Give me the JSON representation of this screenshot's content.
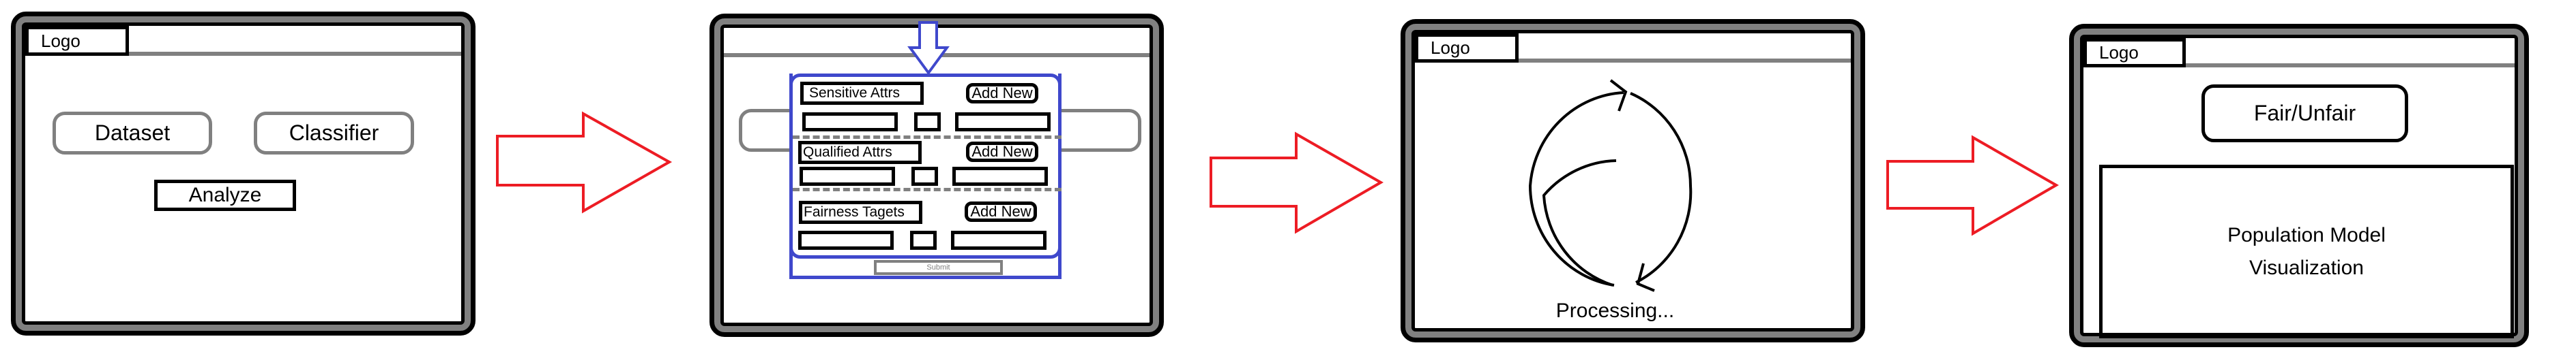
{
  "colors": {
    "flow_arrow": "#ed1c24",
    "modal_border": "#3f48cc",
    "frame_gray": "#808080"
  },
  "screen1": {
    "logo": "Logo",
    "dataset_button": "Dataset",
    "classifier_button": "Classifier",
    "analyze_button": "Analyze"
  },
  "screen2": {
    "sections": [
      {
        "label": "Sensitive Attrs",
        "add_label": "Add New"
      },
      {
        "label": "Qualified Attrs",
        "add_label": "Add New"
      },
      {
        "label": "Fairness Tagets",
        "add_label": "Add New"
      }
    ],
    "submit_label": "Submit"
  },
  "screen3": {
    "logo": "Logo",
    "status_text": "Processing...",
    "icon": "refresh-cycle-icon"
  },
  "screen4": {
    "logo": "Logo",
    "result_label": "Fair/Unfair",
    "visualization_line1": "Population Model",
    "visualization_line2": "Visualization"
  }
}
